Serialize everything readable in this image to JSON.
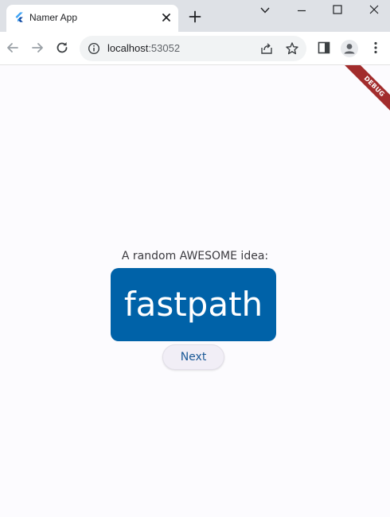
{
  "browser": {
    "tab": {
      "title": "Namer App",
      "favicon": "flutter-icon"
    },
    "address": {
      "host": "localhost",
      "port": ":53052"
    },
    "icons": [
      "chevron-down-icon",
      "minimize-icon",
      "maximize-icon",
      "close-icon",
      "back-icon",
      "forward-icon",
      "reload-icon",
      "info-icon",
      "share-icon",
      "star-icon",
      "side-panel-icon",
      "profile-icon",
      "menu-icon",
      "new-tab-icon"
    ]
  },
  "banner": {
    "label": "DEBUG",
    "color": "#a22c2c"
  },
  "app": {
    "prompt": "A random AWESOME idea:",
    "word": "fastpath",
    "next_label": "Next",
    "accent": "#0062a8",
    "background": "#fcfbfe"
  }
}
